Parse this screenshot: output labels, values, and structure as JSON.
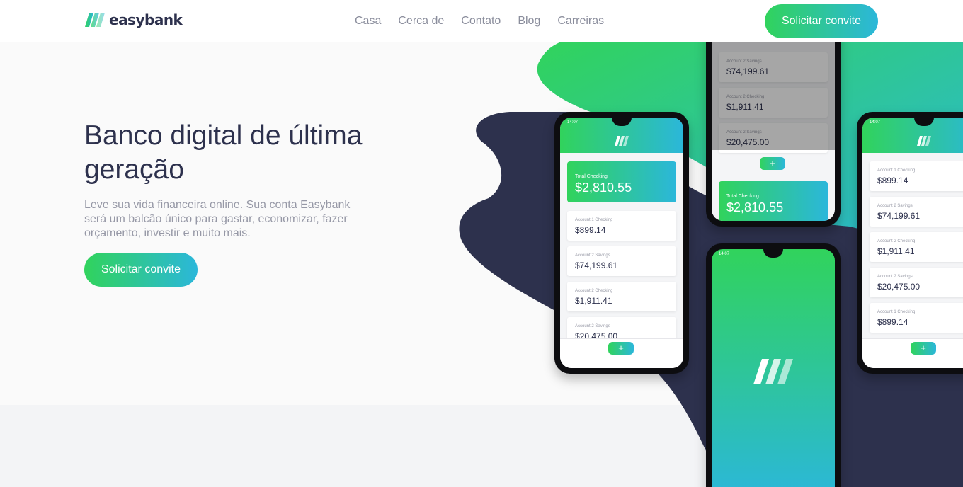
{
  "header": {
    "logo_text": "easybank",
    "nav": [
      "Casa",
      "Cerca de",
      "Contato",
      "Blog",
      "Carreiras"
    ],
    "cta_label": "Solicitar convite"
  },
  "hero": {
    "title": "Banco digital de última geração",
    "text": "Leve sua vida financeira online. Sua conta Easybank será um balcão único para gastar, economizar, fazer orçamento, investir e muito mais.",
    "cta_label": "Solicitar convite"
  },
  "phones": {
    "status_time": "14:07",
    "total": {
      "label": "Total Checking",
      "amount": "$2,810.55"
    },
    "accounts_left": [
      {
        "label": "Account 1 Checking",
        "amount": "$899.14"
      },
      {
        "label": "Account 2 Savings",
        "amount": "$74,199.61"
      },
      {
        "label": "Account 2 Checking",
        "amount": "$1,911.41"
      },
      {
        "label": "Account 2 Savings",
        "amount": "$20,475.00"
      }
    ],
    "accounts_top": [
      {
        "label": "Account 2 Savings",
        "amount": "$74,199.61"
      },
      {
        "label": "Account 2 Checking",
        "amount": "$1,911.41"
      },
      {
        "label": "Account 2 Savings",
        "amount": "$20,475.00"
      }
    ],
    "accounts_right": [
      {
        "label": "Account 1 Checking",
        "amount": "$899.14"
      },
      {
        "label": "Account 2 Savings",
        "amount": "$74,199.61"
      },
      {
        "label": "Account 2 Checking",
        "amount": "$1,911.41"
      },
      {
        "label": "Account 2 Savings",
        "amount": "$20,475.00"
      },
      {
        "label": "Account 1 Checking",
        "amount": "$899.14"
      }
    ],
    "plus_symbol": "+"
  },
  "colors": {
    "primary_dark": "#2d314d",
    "lime_green": "#31d35c",
    "bright_cyan": "#2bb7da",
    "grayish_blue": "#9698a6"
  },
  "icons": {
    "logo": "easybank-logo-icon"
  }
}
